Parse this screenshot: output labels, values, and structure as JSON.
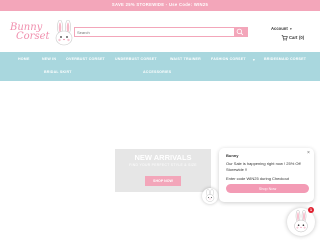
{
  "announcement": {
    "text": "SAVE 25% STOREWIDE - Use Code: WIN25"
  },
  "logo": {
    "line1": "Bunny",
    "line2": "Corset"
  },
  "search": {
    "placeholder": "Search"
  },
  "header": {
    "account_label": "Account",
    "cart_label": "Cart",
    "cart_count": "(0)"
  },
  "nav": {
    "items": [
      {
        "label": "HOME"
      },
      {
        "label": "NEW IN"
      },
      {
        "label": "OVERBUST CORSET"
      },
      {
        "label": "UNDERBUST CORSET"
      },
      {
        "label": "WAIST TRAINER"
      },
      {
        "label": "FASHION CORSET"
      },
      {
        "label": "BRIDESMAID CORSET"
      },
      {
        "label": "BRIDAL SKIRT"
      },
      {
        "label": "ACCESSORIES"
      }
    ]
  },
  "banner": {
    "title": "NEW ARRIVALS",
    "subtitle": "FIND YOUR PERFECT STYLE & SIZE",
    "button": "SHOP NOW"
  },
  "chat": {
    "name": "Bunny",
    "close": "×",
    "message1": "Our Sale is happening right now ! 25% Off Storewide !!",
    "message2": "Enter code WIN25 during Checkout",
    "button": "Shop Now",
    "badge": "1"
  },
  "colors": {
    "brand_pink": "#f3a6ba",
    "nav_teal": "#a9d7de",
    "badge_red": "#e0202f"
  }
}
